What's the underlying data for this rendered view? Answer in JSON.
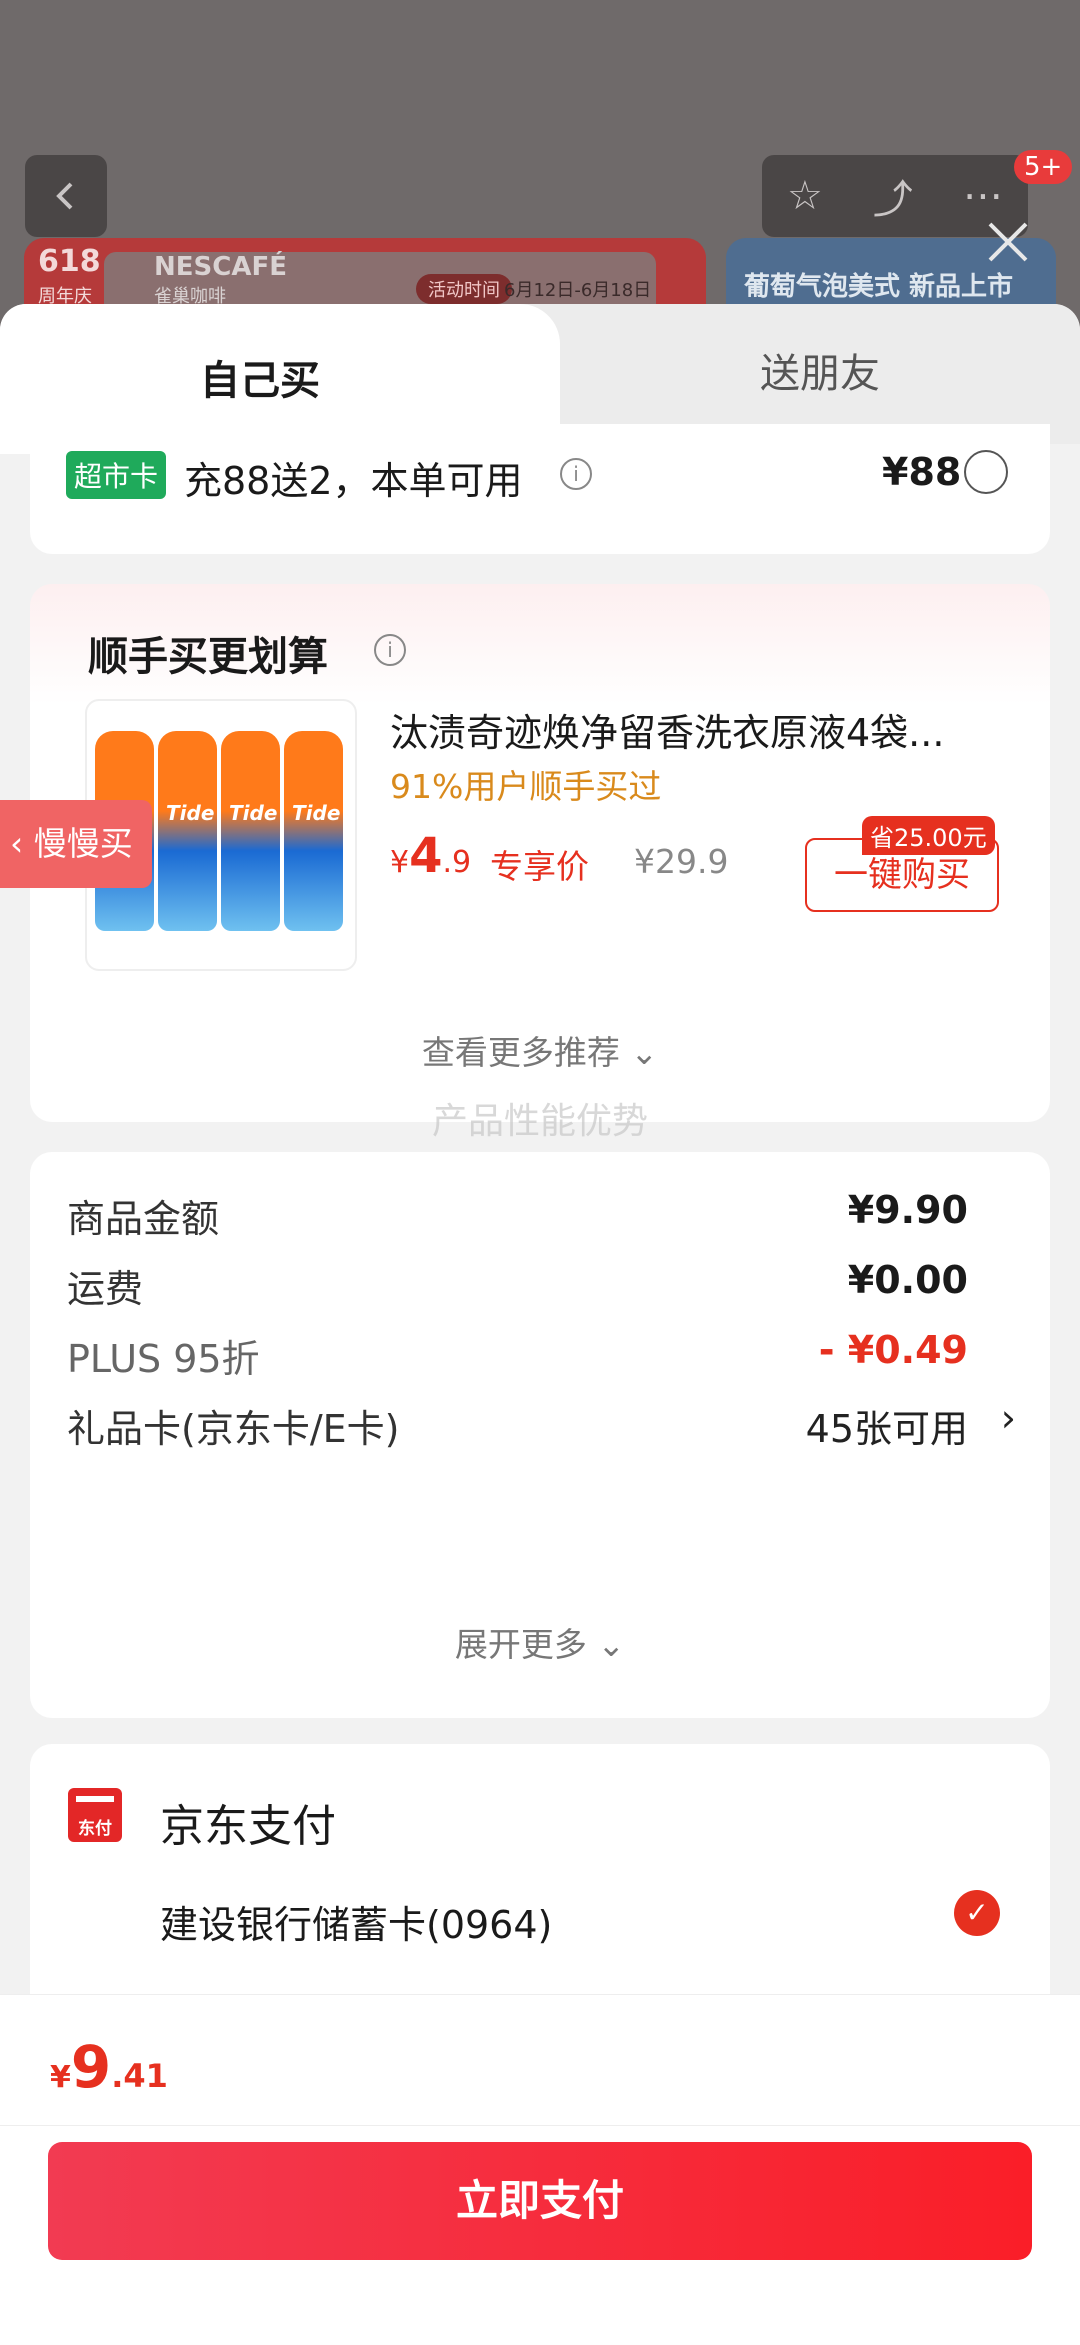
{
  "background": {
    "banner_left": {
      "t618": "618",
      "tz": "周年庆",
      "brand": "NESCAFÉ",
      "brand_cn": "雀巢咖啡",
      "activity": "活动时间",
      "dates": "6月12日-6月18日"
    },
    "banner_right": {
      "text": "葡萄气泡美式 新品上市"
    },
    "top_badge": "5+"
  },
  "tabs": [
    {
      "label": "自己买"
    },
    {
      "label": "送朋友"
    }
  ],
  "promo_card": {
    "tag": "超市卡",
    "text": "充88送2，本单可用",
    "price": "¥88"
  },
  "recommend": {
    "title": "顺手买更划算",
    "product": {
      "name": "汰渍奇迹焕净留香洗衣原液4袋...",
      "sub": "91%用户顺手买过",
      "currency": "¥",
      "price_int": "4",
      "price_dec": ".9",
      "price_label": "专享价",
      "original_price": "¥29.9",
      "save_tag": "省25.00元",
      "buy_label": "一键购买"
    },
    "more": "查看更多推荐 ⌄"
  },
  "slow_buy": "慢慢买",
  "watermark": "产品性能优势",
  "summary": {
    "rows": [
      {
        "label": "商品金额",
        "value": "¥9.90"
      },
      {
        "label": "运费",
        "value": "¥0.00"
      },
      {
        "label": "PLUS 95折",
        "value": "- ¥0.49"
      },
      {
        "label": "礼品卡(京东卡/E卡)",
        "value": "45张可用"
      }
    ],
    "expand": "展开更多 ⌄"
  },
  "payment": {
    "icon_label": "东付",
    "title": "京东支付",
    "card": "建设银行储蓄卡(0964)"
  },
  "footer": {
    "currency": "¥",
    "total_int": "9",
    "total_dec": ".41",
    "pay_button": "立即支付"
  },
  "colors": {
    "accent": "#e6301f",
    "pay_button": "#f5263a",
    "supermarket_tag": "#1faa5b"
  }
}
